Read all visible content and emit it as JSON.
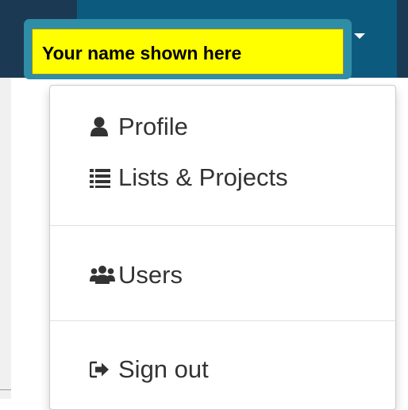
{
  "header": {
    "user_name_placeholder": "Your name shown here"
  },
  "menu": {
    "items": [
      {
        "label": "Profile",
        "icon": "user-icon"
      },
      {
        "label": "Lists & Projects",
        "icon": "list-icon"
      },
      {
        "label": "Users",
        "icon": "users-icon"
      },
      {
        "label": "Sign out",
        "icon": "sign-out-icon"
      }
    ]
  },
  "colors": {
    "navbar": "#0c5b7f",
    "navbar_dark": "#1c3954",
    "callout_border": "#2f8da6",
    "callout_fill": "#ffff00",
    "menu_text": "#333333"
  }
}
